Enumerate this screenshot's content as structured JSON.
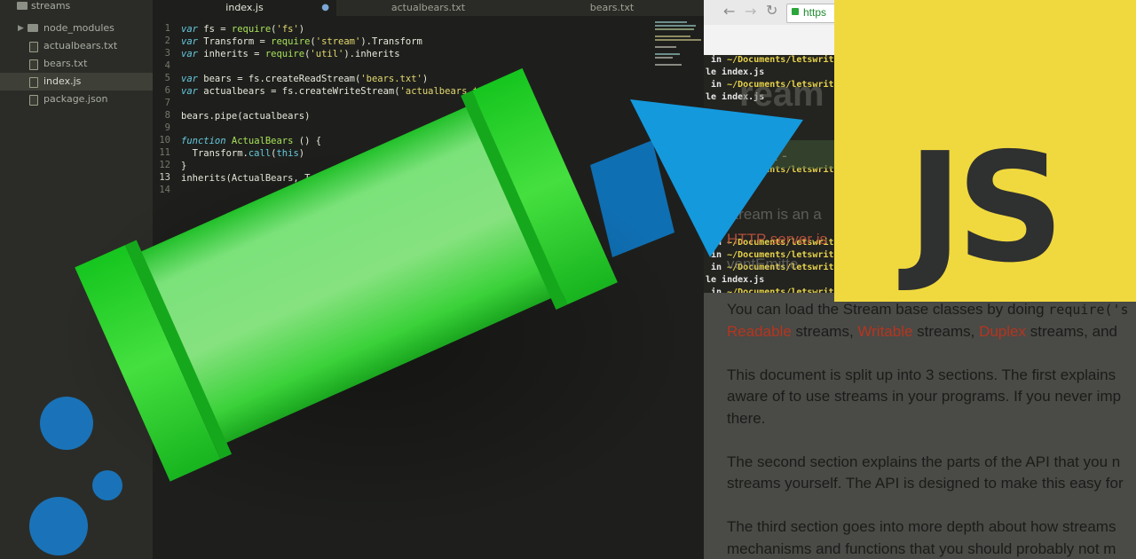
{
  "sidebar": {
    "root_folder": "streams",
    "items": [
      {
        "label": "node_modules",
        "type": "folder"
      },
      {
        "label": "actualbears.txt",
        "type": "file"
      },
      {
        "label": "bears.txt",
        "type": "file"
      },
      {
        "label": "index.js",
        "type": "file",
        "active": true
      },
      {
        "label": "package.json",
        "type": "file"
      }
    ]
  },
  "tabs": [
    {
      "label": "index.js",
      "active": true,
      "modified_marker": "●"
    },
    {
      "label": "actualbears.txt",
      "active": false
    },
    {
      "label": "bears.txt",
      "active": false
    }
  ],
  "editor": {
    "line_numbers": [
      "1",
      "2",
      "3",
      "4",
      "5",
      "6",
      "7",
      "8",
      "9",
      "10",
      "11",
      "12",
      "13",
      "14"
    ],
    "current_line": "13",
    "lines": [
      [
        {
          "t": "var",
          "c": "kw"
        },
        {
          "t": " fs = "
        },
        {
          "t": "require",
          "c": "fn"
        },
        {
          "t": "("
        },
        {
          "t": "'fs'",
          "c": "st"
        },
        {
          "t": ")"
        }
      ],
      [
        {
          "t": "var",
          "c": "kw"
        },
        {
          "t": " Transform = "
        },
        {
          "t": "require",
          "c": "fn"
        },
        {
          "t": "("
        },
        {
          "t": "'stream'",
          "c": "st"
        },
        {
          "t": ").Transform"
        }
      ],
      [
        {
          "t": "var",
          "c": "kw"
        },
        {
          "t": " inherits = "
        },
        {
          "t": "require",
          "c": "fn"
        },
        {
          "t": "("
        },
        {
          "t": "'util'",
          "c": "st"
        },
        {
          "t": ").inherits"
        }
      ],
      [],
      [
        {
          "t": "var",
          "c": "kw"
        },
        {
          "t": " bears = fs.createReadStream("
        },
        {
          "t": "'bears.txt'",
          "c": "st"
        },
        {
          "t": ")"
        }
      ],
      [
        {
          "t": "var",
          "c": "kw"
        },
        {
          "t": " actualbears = fs.createWriteStream("
        },
        {
          "t": "'actualbears.txt'",
          "c": "st"
        },
        {
          "t": ")"
        }
      ],
      [],
      [
        {
          "t": "bears.pipe(actualbears)"
        }
      ],
      [],
      [
        {
          "t": "function",
          "c": "kw"
        },
        {
          "t": " "
        },
        {
          "t": "ActualBears",
          "c": "fn"
        },
        {
          "t": " () {"
        }
      ],
      [
        {
          "t": "  Transform."
        },
        {
          "t": "call",
          "c": "bi"
        },
        {
          "t": "("
        },
        {
          "t": "this",
          "c": "bi"
        },
        {
          "t": ")"
        }
      ],
      [
        {
          "t": "}"
        }
      ],
      [
        {
          "t": "inherits(ActualBears, Transform)"
        }
      ],
      []
    ]
  },
  "browser": {
    "url_text": "https",
    "terminal_lines": [
      {
        "prefix": " in ",
        "path": "~/Documents/letswritecod"
      },
      {
        "prefix": "le index.js",
        "path": ""
      },
      {
        "prefix": " in ",
        "path": "~/Documents/letswritecod"
      },
      {
        "prefix": "le index.js",
        "path": ""
      },
      {
        "prefix": " in ",
        "path": "~/Documents/letswritecod"
      },
      {
        "prefix": " in ",
        "path": "~/Documents/letswritecod"
      },
      {
        "prefix": " in ",
        "path": "~/Documents/letswritecod"
      },
      {
        "prefix": " in ",
        "path": "~/Documents/letswritecod"
      },
      {
        "prefix": "le index.js",
        "path": ""
      },
      {
        "prefix": " in ",
        "path": "~/Documents/letswritecod"
      }
    ],
    "ghost_heading": "ream",
    "ghost_stability": "ility: 2 -",
    "ghost_lines": [
      "stream is an a",
      "HTTP server is",
      "ventEmitte"
    ],
    "doc_paragraphs": [
      [
        {
          "t": "You can load the Stream base classes by doing "
        },
        {
          "t": "require('s",
          "c": "mono"
        }
      ],
      [
        {
          "t": "Readable",
          "c": "lnk"
        },
        {
          "t": " streams, "
        },
        {
          "t": "Writable",
          "c": "lnk"
        },
        {
          "t": " streams, "
        },
        {
          "t": "Duplex",
          "c": "lnk"
        },
        {
          "t": " streams, and"
        }
      ],
      [],
      [
        {
          "t": "This document is split up into 3 sections. The first explains"
        }
      ],
      [
        {
          "t": "aware of to use streams in your programs. If you never imp"
        }
      ],
      [
        {
          "t": "there."
        }
      ],
      [],
      [
        {
          "t": "The second section explains the parts of the API that you n"
        }
      ],
      [
        {
          "t": "streams yourself. The API is designed to make this easy for"
        }
      ],
      [],
      [
        {
          "t": "The third section goes into more depth about how streams"
        }
      ],
      [
        {
          "t": "mechanisms and functions that you should probably not m"
        }
      ]
    ]
  },
  "logo": {
    "text": "JS",
    "background": "#f0d93e",
    "color": "#2f3030"
  },
  "colors": {
    "pipe_green": "#4ee04e",
    "arrow_blue": "#1499dd",
    "bubble_blue": "#1a73b8"
  }
}
